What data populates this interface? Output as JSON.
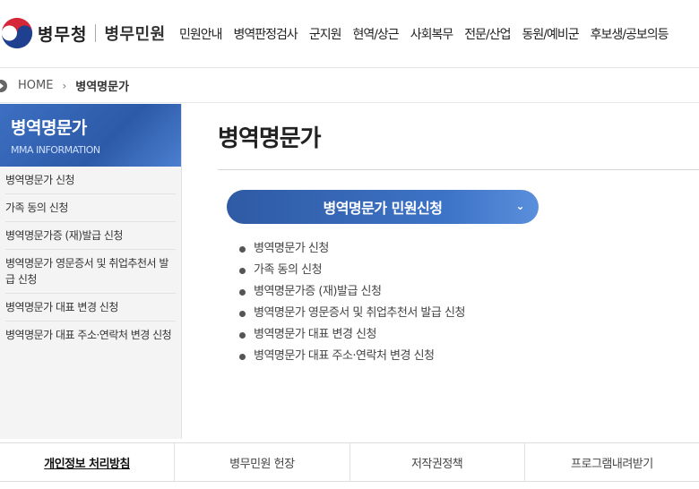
{
  "header": {
    "org_name": "병무청",
    "service_name": "병무민원",
    "nav": [
      {
        "label": "민원안내"
      },
      {
        "label": "병역판정검사"
      },
      {
        "label": "군지원"
      },
      {
        "label": "현역/상근"
      },
      {
        "label": "사회복무"
      },
      {
        "label": "전문/산업"
      },
      {
        "label": "동원/예비군"
      },
      {
        "label": "후보생/공보의등"
      }
    ]
  },
  "breadcrumb": {
    "home": "HOME",
    "separator": "›",
    "current": "병역명문가"
  },
  "sidebar": {
    "title": "병역명문가",
    "subtitle": "MMA INFORMATION",
    "items": [
      {
        "label": "병역명문가 신청"
      },
      {
        "label": "가족 동의 신청"
      },
      {
        "label": "병역명문가증 (재)발급 신청"
      },
      {
        "label": "병역명문가 영문증서 및 취업추천서 발급 신청"
      },
      {
        "label": "병역명문가 대표 변경 신청"
      },
      {
        "label": "병역명문가 대표 주소·연락처 변경 신청"
      }
    ]
  },
  "main": {
    "title": "병역명문가",
    "civil_button": "병역명문가 민원신청",
    "chevron": "⌄",
    "items": [
      {
        "label": "병역명문가 신청"
      },
      {
        "label": "가족 동의 신청"
      },
      {
        "label": "병역명문가증 (재)발급 신청"
      },
      {
        "label": "병역명문가 영문증서 및 취업추천서 발급 신청"
      },
      {
        "label": "병역명문가 대표 변경 신청"
      },
      {
        "label": "병역명문가 대표 주소·연락처 변경 신청"
      }
    ]
  },
  "footer": {
    "links": [
      {
        "label": "개인정보 처리방침"
      },
      {
        "label": "병무민원 헌장"
      },
      {
        "label": "저작권정책"
      },
      {
        "label": "프로그램내려받기"
      }
    ]
  },
  "colors": {
    "accent": "#2f5aa4",
    "emblem_red": "#d5263a",
    "emblem_blue": "#1f3f8f"
  }
}
